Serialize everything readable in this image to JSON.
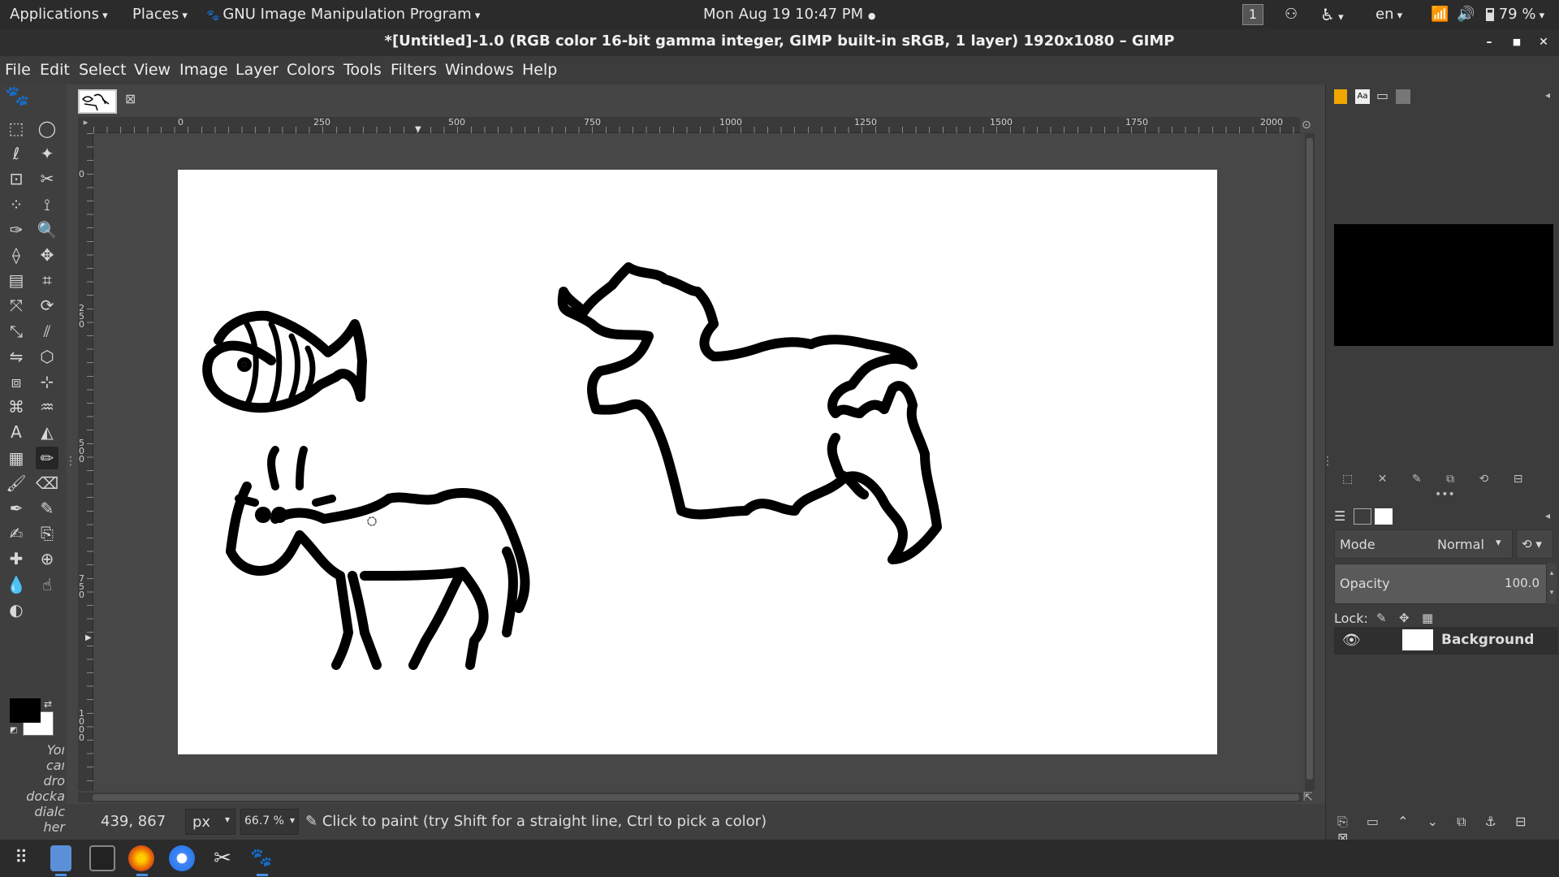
{
  "top_panel": {
    "applications": "Applications",
    "places": "Places",
    "app_name": "GNU Image Manipulation Program",
    "clock": "Mon Aug 19  10:47 PM",
    "workspace": "1",
    "language": "en",
    "battery": "79 %"
  },
  "window": {
    "title": "*[Untitled]-1.0 (RGB color 16-bit gamma integer, GIMP built-in sRGB, 1 layer) 1920x1080 – GIMP"
  },
  "menus": [
    "File",
    "Edit",
    "Select",
    "View",
    "Image",
    "Layer",
    "Colors",
    "Tools",
    "Filters",
    "Windows",
    "Help"
  ],
  "ruler": {
    "h_ticks": [
      "0",
      "250",
      "500",
      "750",
      "1000",
      "1250",
      "1500",
      "1750",
      "2000"
    ],
    "v_ticks": [
      "0",
      "250",
      "500",
      "750",
      "1000"
    ]
  },
  "statusbar": {
    "coords": "439, 867",
    "unit": "px",
    "zoom": "66.7 %",
    "message": "Click to paint (try Shift for a straight line, Ctrl to pick a color)"
  },
  "toolbox_hint": "You can drop dockable dialogs here",
  "toolbox_hint_visible": [
    "Yoı",
    "caı",
    "dro",
    "docka",
    "dialc",
    "her"
  ],
  "layers": {
    "mode_label": "Mode",
    "mode_value": "Normal",
    "opacity_label": "Opacity",
    "opacity_value": "100.0",
    "lock_label": "Lock:",
    "layer_name": "Background"
  },
  "colors": {
    "accent_fg": "#000000",
    "accent_bg": "#ffffff",
    "panel": "#2b2b2b"
  },
  "icons": {
    "tools": [
      "rect-select-icon",
      "ellipse-select-icon",
      "free-select-icon",
      "fuzzy-select-icon",
      "foreground-select-icon",
      "scissors-icon",
      "by-color-select-icon",
      "paths-icon",
      "color-picker-icon",
      "zoom-icon",
      "measure-icon",
      "move-icon",
      "align-icon",
      "crop-icon",
      "unified-transform-icon",
      "rotate-icon",
      "scale-icon",
      "shear-icon",
      "flip-icon",
      "perspective-icon",
      "3d-transform-icon",
      "handle-transform-icon",
      "cage-transform-icon",
      "warp-transform-icon",
      "text-icon",
      "bucket-fill-icon",
      "gradient-icon",
      "pencil-icon",
      "paintbrush-icon",
      "eraser-icon",
      "airbrush-icon",
      "ink-icon",
      "mypaint-brush-icon",
      "clone-icon",
      "heal-icon",
      "perspective-clone-icon",
      "blur-icon",
      "smudge-icon",
      "dodge-burn-icon"
    ]
  }
}
